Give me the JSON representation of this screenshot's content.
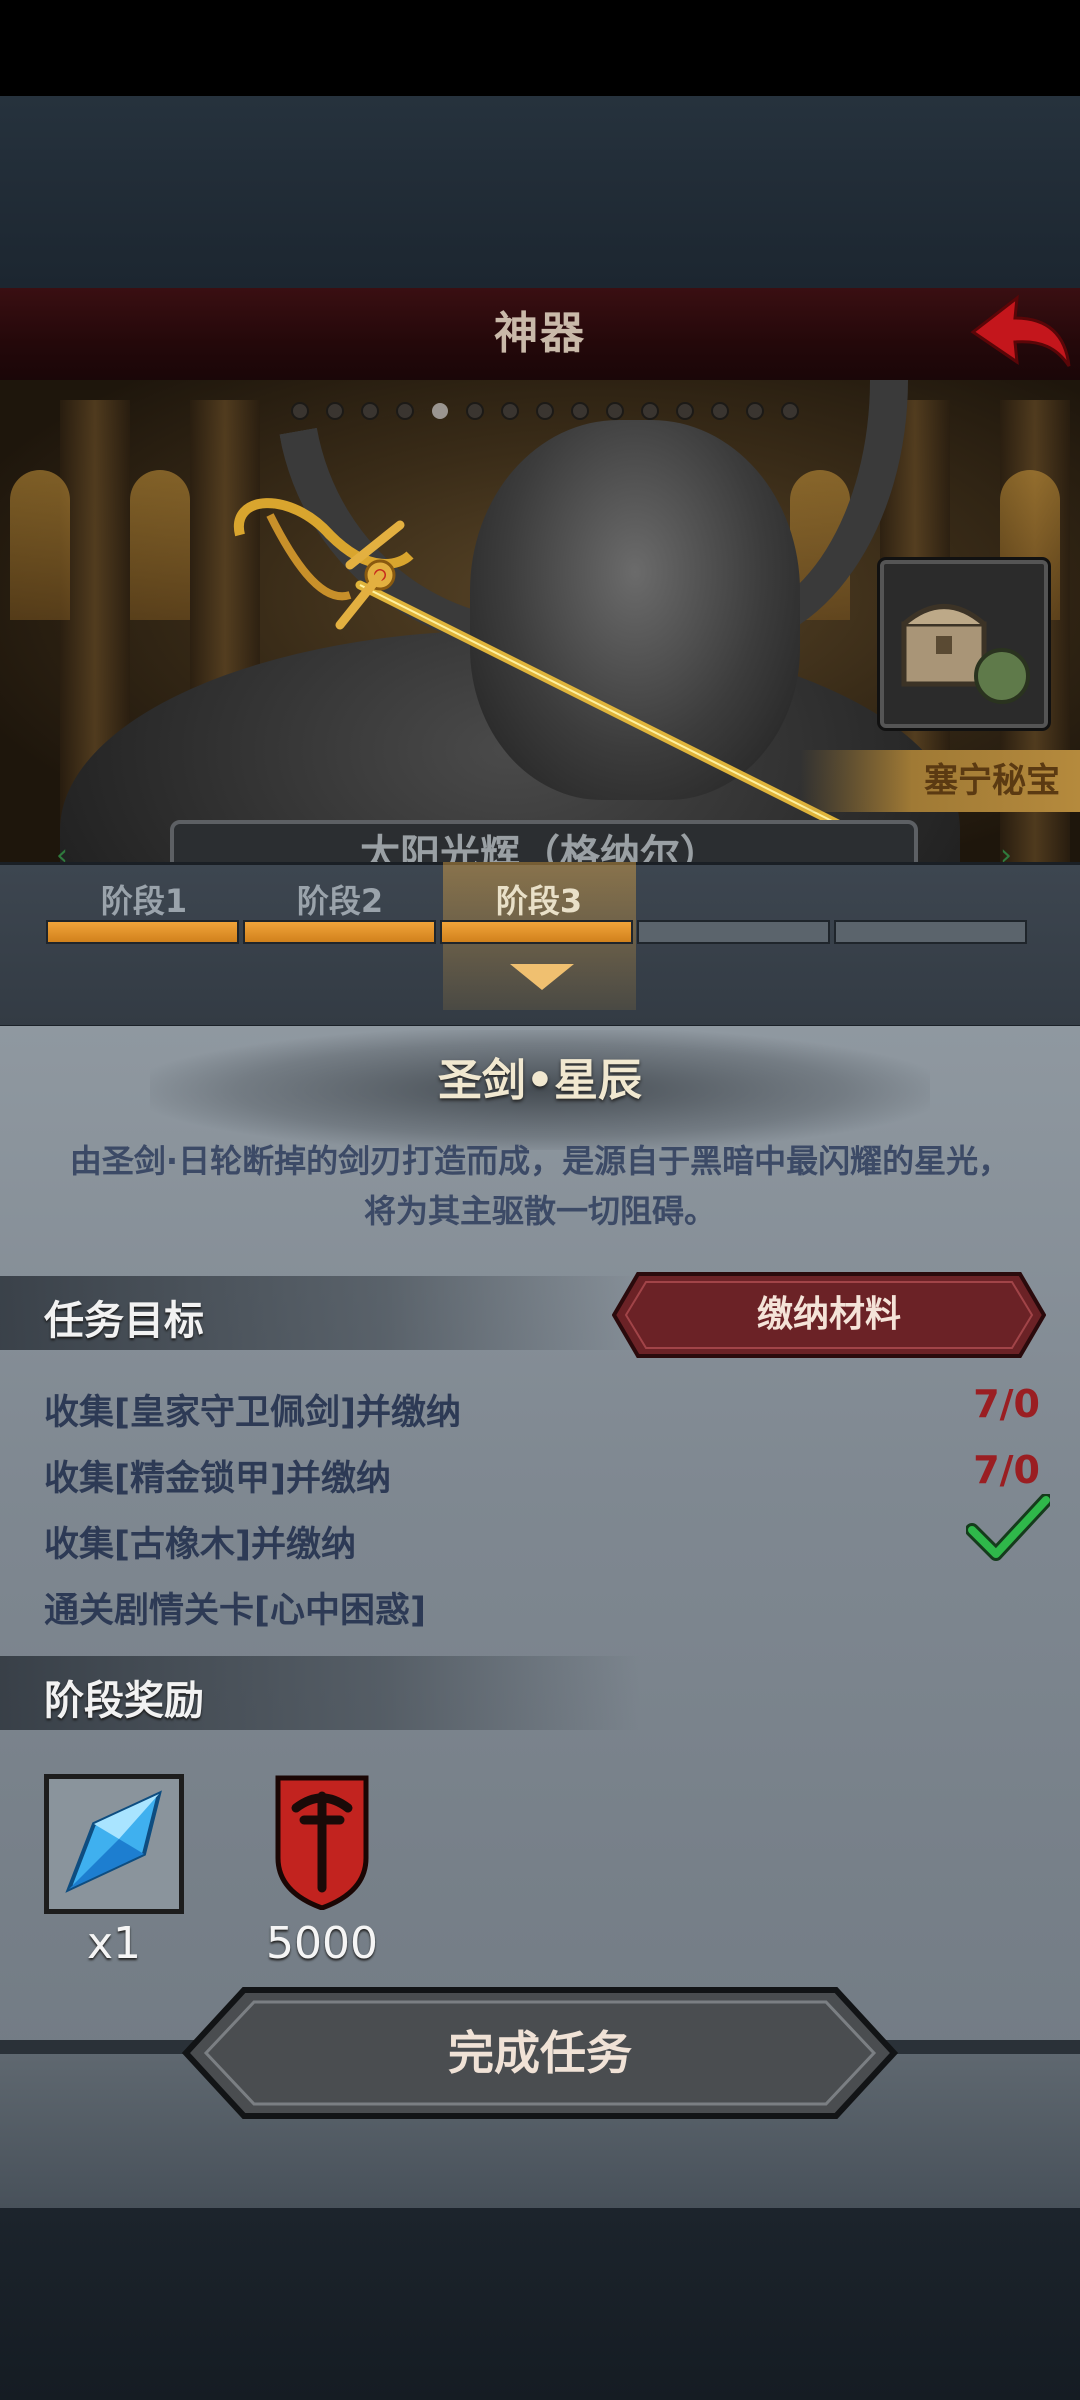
{
  "header": {
    "title": "神器"
  },
  "banner": {
    "secret_treasure_label": "塞宁秘宝",
    "name_plate_text": "太阳光辉（格纳尔）"
  },
  "stages": [
    {
      "label": "阶段1",
      "active": false,
      "complete": true
    },
    {
      "label": "阶段2",
      "active": false,
      "complete": true
    },
    {
      "label": "阶段3",
      "active": true,
      "complete": true
    },
    {
      "label": "",
      "active": false,
      "complete": false
    },
    {
      "label": "",
      "active": false,
      "complete": false
    }
  ],
  "item": {
    "title": "圣剑•星辰",
    "description_line1": "由圣剑·日轮断掉的剑刃打造而成，是源自于黑暗中最闪耀的星光，",
    "description_line2": "将为其主驱散一切阻碍。"
  },
  "tasks": {
    "section_title": "任务目标",
    "submit_button": "缴纳材料",
    "items": [
      {
        "text": "收集[皇家守卫佩剑]并缴纳",
        "progress": "7/0"
      },
      {
        "text": "收集[精金锁甲]并缴纳",
        "progress": "7/0"
      },
      {
        "text": "收集[古橡木]并缴纳",
        "progress": "done"
      },
      {
        "text": "通关剧情关卡[心中困惑]",
        "progress": ""
      }
    ]
  },
  "rewards": {
    "section_title": "阶段奖励",
    "items": [
      {
        "icon": "crystal-icon",
        "count": "x1"
      },
      {
        "icon": "shield-emblem-icon",
        "count": "5000"
      }
    ]
  },
  "complete_button": "完成任务",
  "colors": {
    "accent_orange": "#e9962c",
    "task_text": "#2d3a55",
    "progress_red": "#9a1e22",
    "check_green": "#2fb84a"
  }
}
